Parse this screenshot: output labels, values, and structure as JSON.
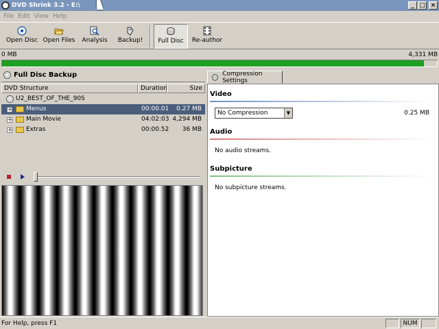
{
  "window": {
    "title": "DVD Shrink 3.2 - E:\\"
  },
  "menu": [
    "File",
    "Edit",
    "View",
    "Help"
  ],
  "toolbar": [
    {
      "label": "Open Disc",
      "icon": "disc-icon"
    },
    {
      "label": "Open Files",
      "icon": "open-folder-icon"
    },
    {
      "label": "Analysis",
      "icon": "magnifier-icon"
    },
    {
      "label": "Backup!",
      "icon": "backup-icon"
    },
    {
      "label": "Full Disc",
      "icon": "disc-stack-icon",
      "active": true
    },
    {
      "label": "Re-author",
      "icon": "film-icon"
    }
  ],
  "sizebar": {
    "left_label": "0 MB",
    "right_label": "4,331 MB",
    "fill_fraction": 0.97,
    "fill_color": "#1fa022"
  },
  "left_panel": {
    "title": "Full Disc Backup",
    "columns": [
      "DVD Structure",
      "Duration",
      "Size"
    ],
    "root": "U2_BEST_OF_THE_90S",
    "rows": [
      {
        "name": "Menus",
        "duration": "00:00.01",
        "size": "0.27 MB",
        "selected": true
      },
      {
        "name": "Main Movie",
        "duration": "04:02:03",
        "size": "4,294 MB"
      },
      {
        "name": "Extras",
        "duration": "00:00.52",
        "size": "36 MB"
      }
    ]
  },
  "right_panel": {
    "tab": "Compression Settings",
    "video": {
      "heading": "Video",
      "select_value": "No Compression",
      "size": "0.25 MB",
      "line_color": "#6d8fc0"
    },
    "audio": {
      "heading": "Audio",
      "text": "No audio streams.",
      "line_color": "#d77a7a"
    },
    "subpicture": {
      "heading": "Subpicture",
      "text": "No subpicture streams.",
      "line_color": "#7fc07f"
    }
  },
  "status": {
    "text": "For Help, press F1",
    "num": "NUM"
  },
  "window_buttons": {
    "minimize": "_",
    "maximize": "□",
    "close": "×"
  }
}
